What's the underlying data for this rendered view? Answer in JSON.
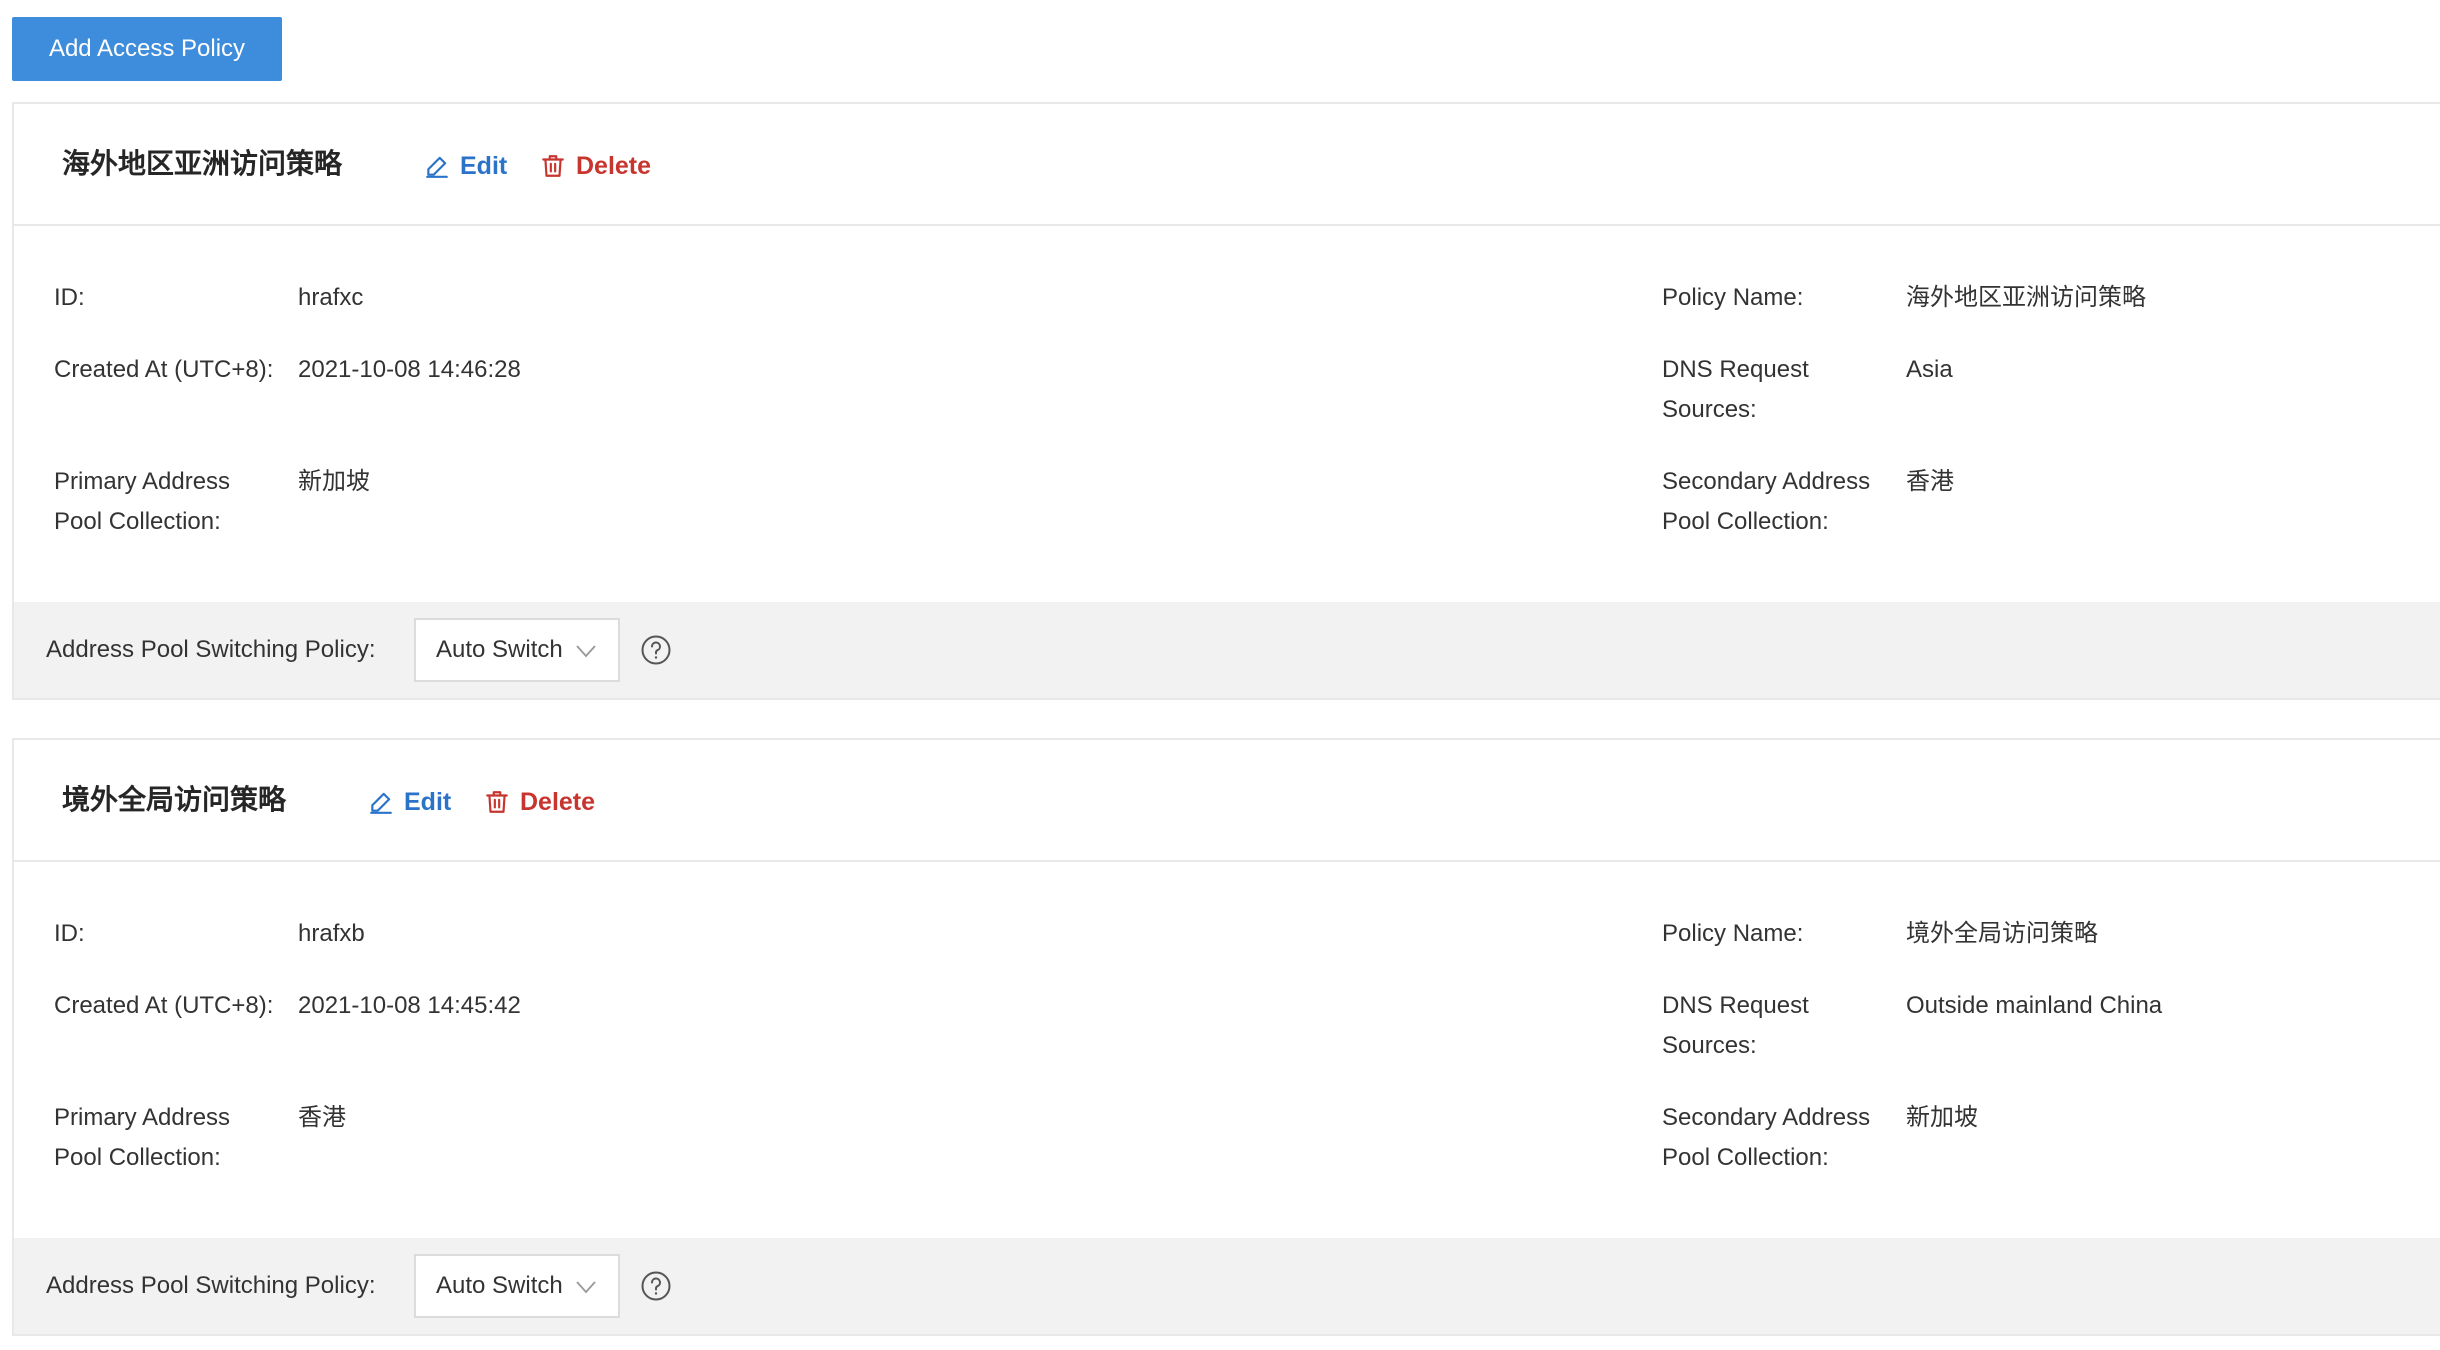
{
  "toolbar": {
    "add_label": "Add Access Policy"
  },
  "labels": {
    "id": "ID:",
    "created_at": "Created At (UTC+8):",
    "primary_pool": "Primary Address Pool Collection:",
    "policy_name": "Policy Name:",
    "dns_sources": "DNS Request Sources:",
    "secondary_pool": "Secondary Address Pool Collection:",
    "switching_policy": "Address Pool Switching Policy:",
    "edit": "Edit",
    "delete": "Delete"
  },
  "policies": [
    {
      "title": "海外地区亚洲访问策略",
      "id": "hrafxc",
      "created_at": "2021-10-08 14:46:28",
      "primary_pool": "新加坡",
      "policy_name": "海外地区亚洲访问策略",
      "dns_sources": "Asia",
      "secondary_pool": "香港",
      "switching_policy": "Auto Switch"
    },
    {
      "title": "境外全局访问策略",
      "id": "hrafxb",
      "created_at": "2021-10-08 14:45:42",
      "primary_pool": "香港",
      "policy_name": "境外全局访问策略",
      "dns_sources": "Outside mainland China",
      "secondary_pool": "新加坡",
      "switching_policy": "Auto Switch"
    }
  ],
  "icons": {
    "edit": "pencil-icon",
    "delete": "trash-icon",
    "select": "chevron-down-icon",
    "help": "question-circle-icon"
  },
  "colors": {
    "primary_button": "#3e8ddc",
    "edit": "#2b73c9",
    "delete": "#c8352f",
    "footer_bg": "#f2f2f2",
    "border": "#e8e8e8"
  }
}
